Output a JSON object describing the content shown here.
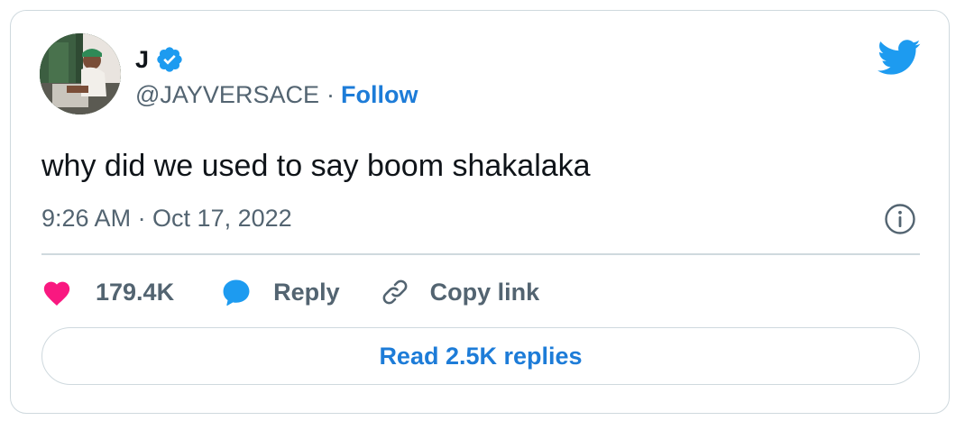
{
  "tweet": {
    "author": {
      "display_name": "J",
      "handle": "@JAYVERSACE",
      "verified": true,
      "separator": "·",
      "follow_label": "Follow"
    },
    "text": "why did we used to say boom shakalaka",
    "timestamp": "9:26 AM · Oct 17, 2022",
    "actions": {
      "likes": "179.4K",
      "reply_label": "Reply",
      "copy_link_label": "Copy link"
    },
    "read_replies_label": "Read 2.5K replies"
  },
  "icons": {
    "brand": "twitter-bird-icon",
    "verified": "verified-badge-icon",
    "info": "info-icon",
    "like": "heart-icon",
    "reply": "speech-bubble-icon",
    "copy": "link-icon"
  },
  "colors": {
    "link_blue": "#1d7cd8",
    "twitter_blue": "#1d9bf0",
    "heart_pink": "#f91880",
    "muted_text": "#536471",
    "border": "#cfd9de"
  }
}
